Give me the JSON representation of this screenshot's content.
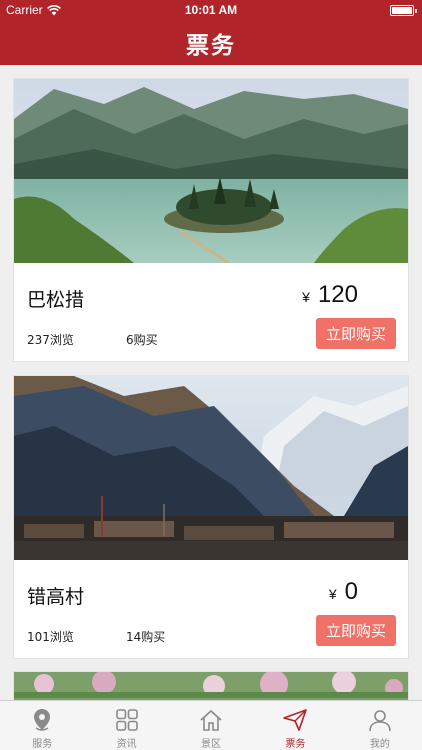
{
  "status": {
    "carrier": "Carrier",
    "time": "10:01 AM"
  },
  "nav": {
    "title": "票务"
  },
  "cards": [
    {
      "name": "巴松措",
      "currency": "¥",
      "price": "120",
      "views": "237浏览",
      "buys": "6购买",
      "buy_label": "立即购买",
      "image": "lake-scenery-photo"
    },
    {
      "name": "错高村",
      "currency": "¥",
      "price": "0",
      "views": "101浏览",
      "buys": "14购买",
      "buy_label": "立即购买",
      "image": "mountain-village-photo"
    }
  ],
  "tabs": [
    {
      "label": "服务",
      "icon": "location-pin-icon",
      "active": false
    },
    {
      "label": "资讯",
      "icon": "grid-icon",
      "active": false
    },
    {
      "label": "景区",
      "icon": "home-icon",
      "active": false
    },
    {
      "label": "票务",
      "icon": "paper-plane-icon",
      "active": true
    },
    {
      "label": "我的",
      "icon": "user-icon",
      "active": false
    }
  ],
  "colors": {
    "brand": "#b1242a",
    "button": "#f07168"
  }
}
